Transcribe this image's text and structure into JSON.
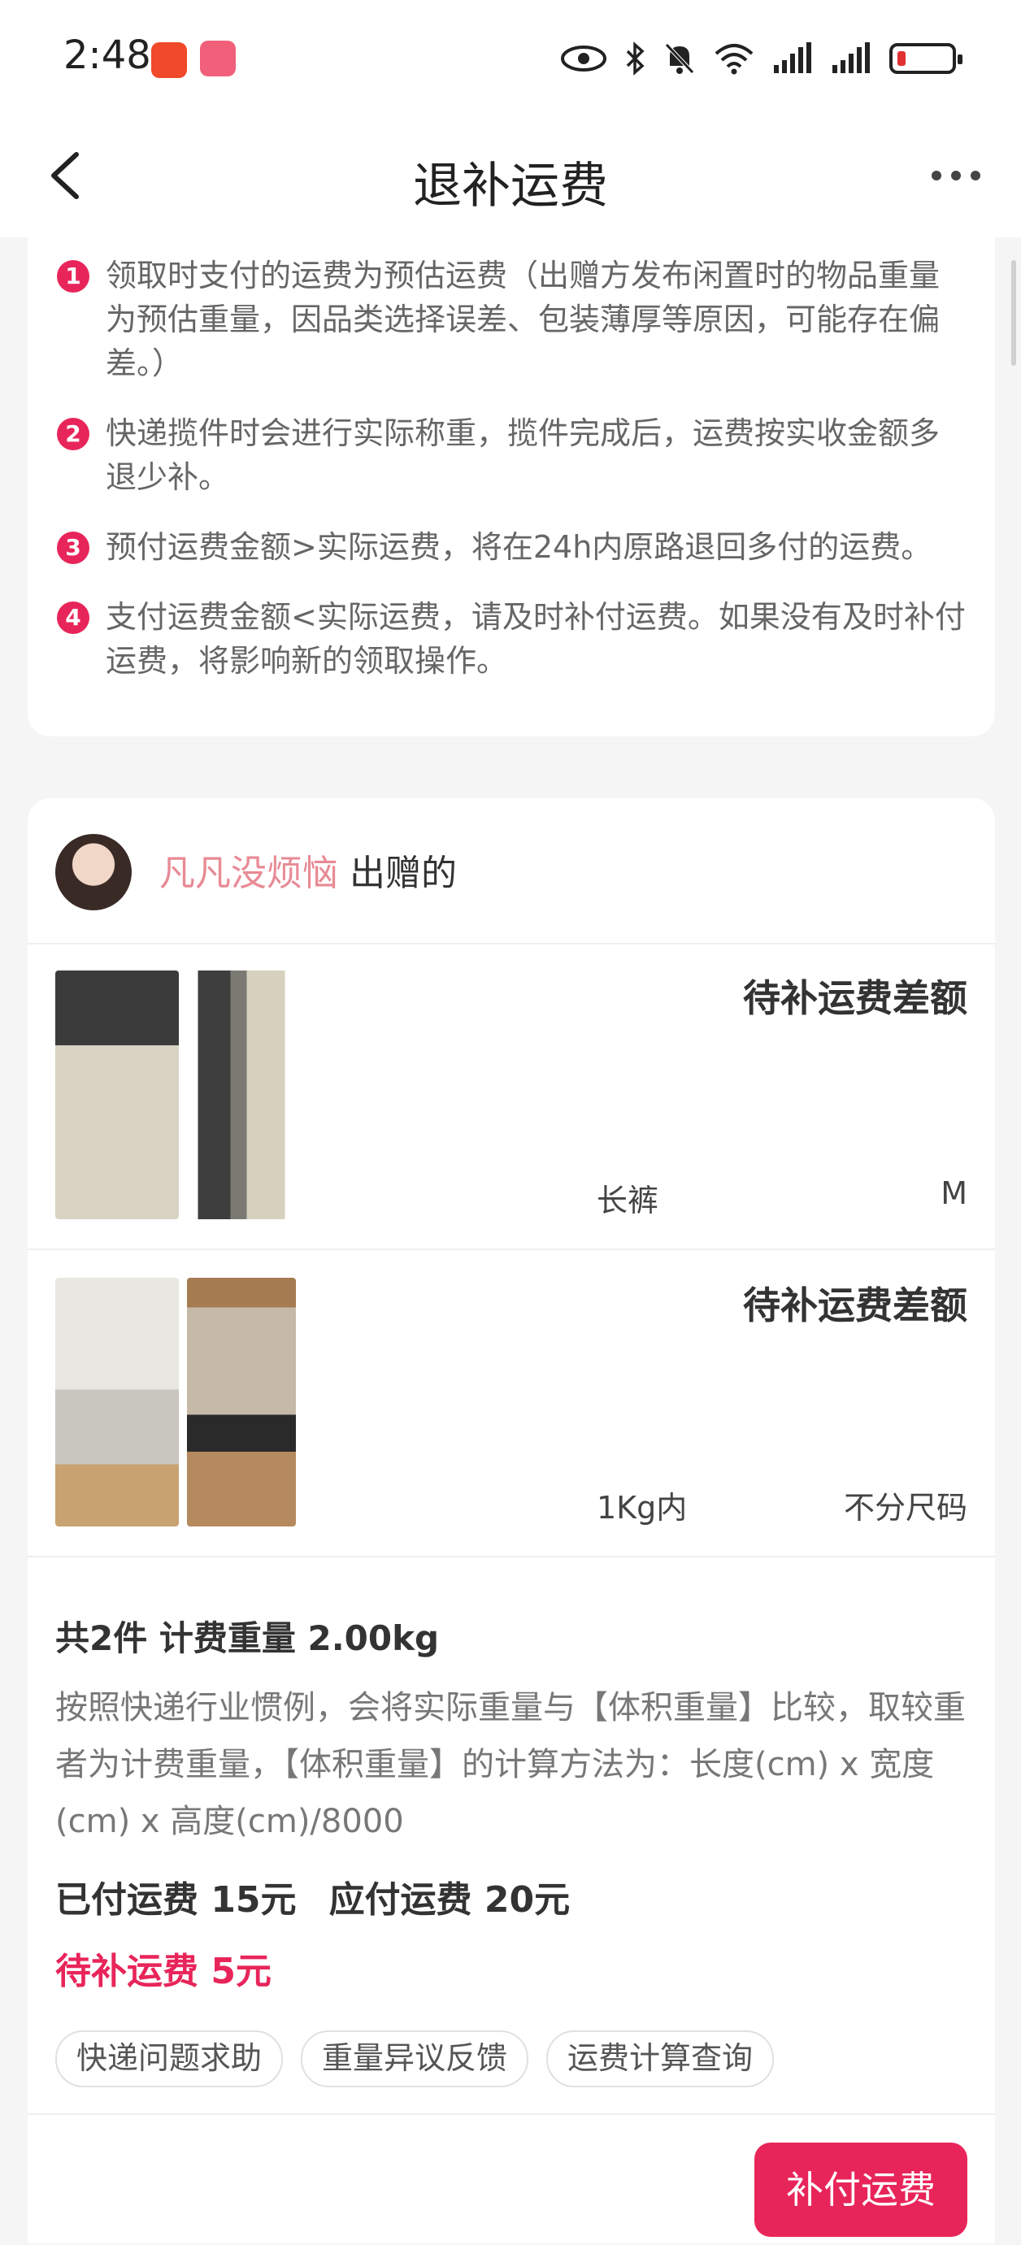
{
  "status_bar": {
    "time": "2:48",
    "icons": [
      "eye-icon",
      "bluetooth-icon",
      "bell-off-icon",
      "wifi-icon",
      "signal-icon",
      "signal-icon",
      "battery-low-icon"
    ]
  },
  "header": {
    "title": "退补运费"
  },
  "notice": {
    "items": [
      {
        "num": "1",
        "text": "领取时支付的运费为预估运费（出赠方发布闲置时的物品重量为预估重量，因品类选择误差、包装薄厚等原因，可能存在偏差。）"
      },
      {
        "num": "2",
        "text": "快递揽件时会进行实际称重，揽件完成后，运费按实收金额多退少补。"
      },
      {
        "num": "3",
        "text": "预付运费金额>实际运费，将在24h内原路退回多付的运费。"
      },
      {
        "num": "4",
        "text": "支付运费金额<实际运费，请及时补付运费。如果没有及时补付运费，将影响新的领取操作。"
      }
    ]
  },
  "gift": {
    "giver_name": "凡凡没烦恼",
    "giver_suffix": "出赠的",
    "items": [
      {
        "status": "待补运费差额",
        "name": "长裤",
        "size": "M"
      },
      {
        "status": "待补运费差额",
        "name": "1Kg内",
        "size": "不分尺码"
      }
    ],
    "summary_title": "共2件 计费重量 2.00kg",
    "summary_desc": "按照快递行业惯例，会将实际重量与【体积重量】比较，取较重者为计费重量，【体积重量】的计算方法为：长度(cm) x 宽度(cm) x 高度(cm)/8000",
    "paid_fee": "已付运费 15元",
    "due_fee": "应付运费 20元",
    "owed_fee": "待补运费 5元",
    "chips": [
      "快递问题求助",
      "重量异议反馈",
      "运费计算查询"
    ],
    "pay_button": "补付运费"
  },
  "colors": {
    "accent": "#e8255a",
    "giver_name": "#e88a95"
  }
}
